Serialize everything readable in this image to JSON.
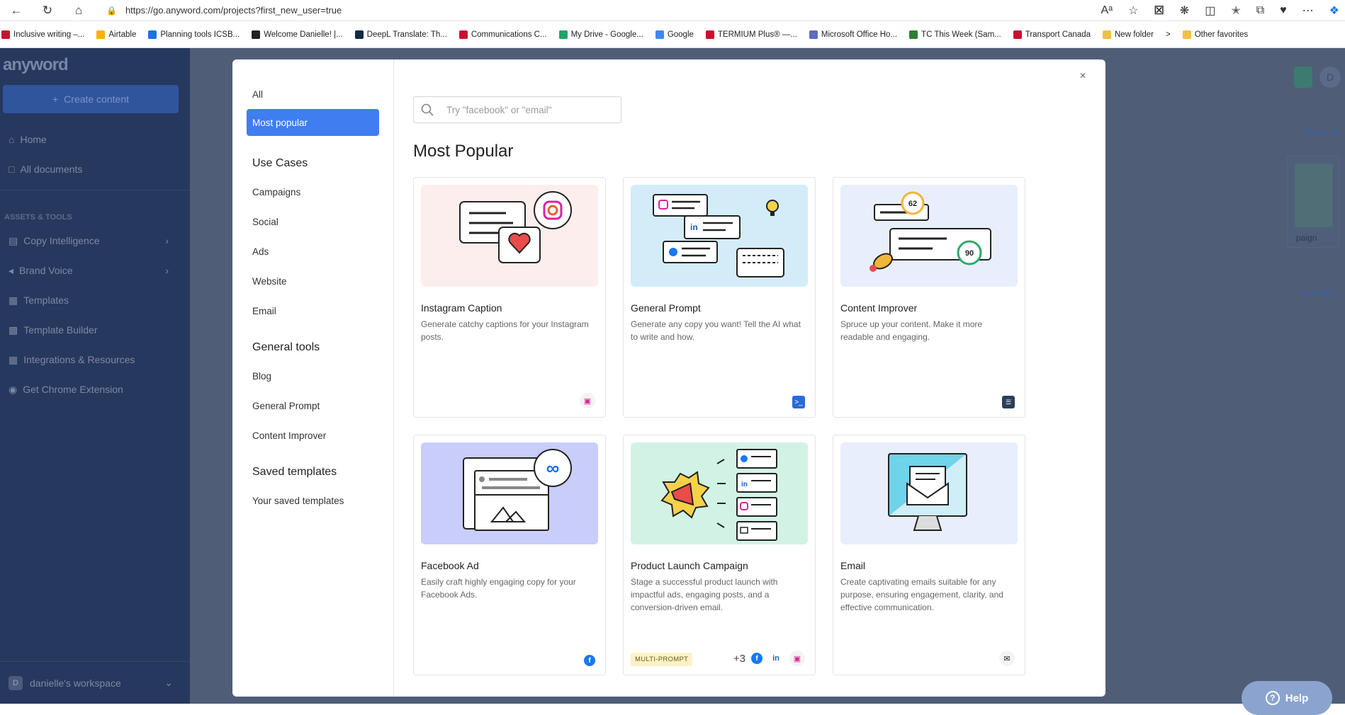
{
  "browser": {
    "url": "https://go.anyword.com/projects?first_new_user=true",
    "bookmarks": [
      {
        "label": "Inclusive writing –...",
        "color": "#c8102e"
      },
      {
        "label": "Airtable",
        "color": "#f8b400"
      },
      {
        "label": "Planning tools ICSB...",
        "color": "#1a73e8"
      },
      {
        "label": "Welcome Danielle! |...",
        "color": "#222222"
      },
      {
        "label": "DeepL Translate: Th...",
        "color": "#0f2b46"
      },
      {
        "label": "Communications C...",
        "color": "#c8102e"
      },
      {
        "label": "My Drive - Google...",
        "color": "#1fa463"
      },
      {
        "label": "Google",
        "color": "#4285f4"
      },
      {
        "label": "TERMIUM Plus® —...",
        "color": "#c8102e"
      },
      {
        "label": "Microsoft Office Ho...",
        "color": "#5c6bc0"
      },
      {
        "label": "TC This Week (Sam...",
        "color": "#2e7d32"
      },
      {
        "label": "Transport Canada",
        "color": "#c8102e"
      },
      {
        "label": "New folder",
        "color": "#f0c040"
      }
    ],
    "other_favorites": "Other favorites"
  },
  "sidebar": {
    "logo": "anyword",
    "create_label": "Create content",
    "nav": [
      {
        "label": "Home",
        "icon": "home-icon"
      },
      {
        "label": "All documents",
        "icon": "folder-icon"
      }
    ],
    "section_label": "ASSETS & TOOLS",
    "tools": [
      {
        "label": "Copy Intelligence",
        "icon": "chart-icon"
      },
      {
        "label": "Brand Voice",
        "icon": "megaphone-icon"
      },
      {
        "label": "Templates",
        "icon": "template-icon"
      },
      {
        "label": "Template Builder",
        "icon": "builder-icon"
      },
      {
        "label": "Integrations & Resources",
        "icon": "grid-icon"
      },
      {
        "label": "Get Chrome Extension",
        "icon": "chrome-icon"
      }
    ],
    "workspace_initial": "D",
    "workspace_label": "danielle's workspace"
  },
  "background": {
    "avatar_initial": "D",
    "show_all": "Show all",
    "card_text": "paign",
    "folder_text": "w folder",
    "help_label": "Help"
  },
  "modal": {
    "close_icon": "×",
    "nav_all": "All",
    "nav_active": "Most popular",
    "use_cases_heading": "Use Cases",
    "use_cases": [
      "Campaigns",
      "Social",
      "Ads",
      "Website",
      "Email"
    ],
    "general_heading": "General tools",
    "general_tools": [
      "Blog",
      "General Prompt",
      "Content Improver"
    ],
    "saved_heading": "Saved templates",
    "saved_items": [
      "Your saved templates"
    ],
    "search_placeholder": "Try \"facebook\" or \"email\"",
    "title": "Most Popular",
    "cards": [
      {
        "title": "Instagram Caption",
        "desc": "Generate catchy captions for your Instagram posts.",
        "bg": "#fdeeee"
      },
      {
        "title": "General Prompt",
        "desc": "Generate any copy you want! Tell the AI what to write and how.",
        "bg": "#d3ecf8"
      },
      {
        "title": "Content Improver",
        "desc": "Spruce up your content. Make it more readable and engaging.",
        "bg": "#e9eefc",
        "score_low": "62",
        "score_high": "90"
      },
      {
        "title": "Facebook Ad",
        "desc": "Easily craft highly engaging copy for your Facebook Ads.",
        "bg": "#c8cdfa"
      },
      {
        "title": "Product Launch Campaign",
        "desc": "Stage a successful product launch with impactful ads, engaging posts, and a conversion-driven email.",
        "bg": "#d2f2e6",
        "badge": "MULTI-PROMPT",
        "more": "+3"
      },
      {
        "title": "Email",
        "desc": "Create captivating emails suitable for any purpose, ensuring engagement, clarity, and effective communication.",
        "bg": "#e9eefc"
      }
    ]
  }
}
